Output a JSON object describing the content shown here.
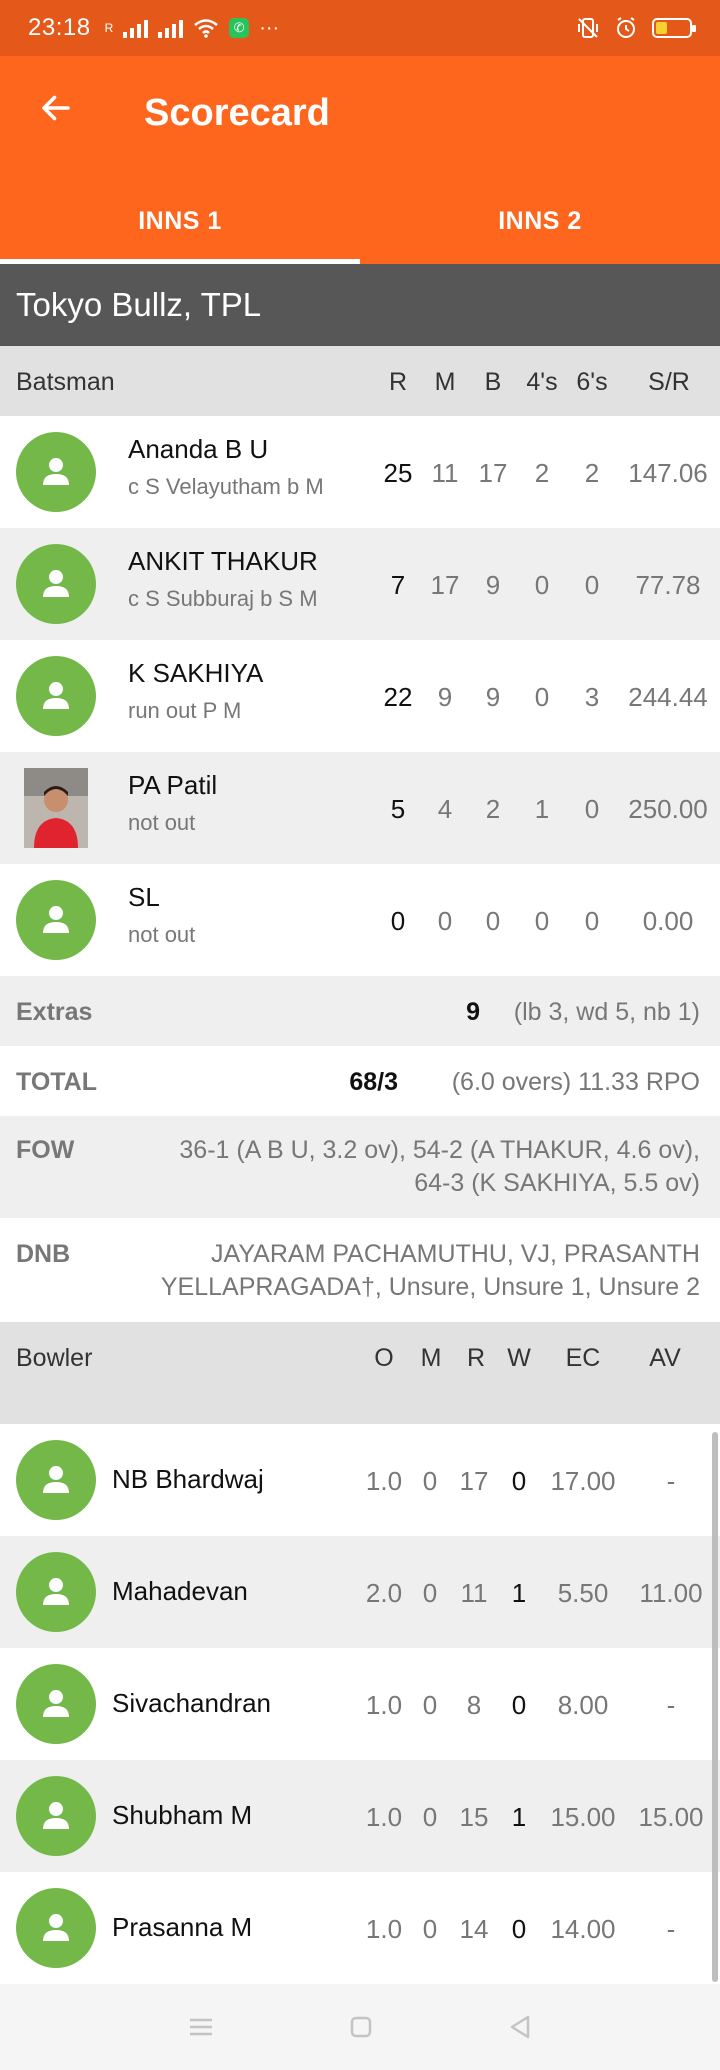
{
  "status": {
    "time": "23:18",
    "signal_label": "R",
    "more": "···"
  },
  "app": {
    "title": "Scorecard"
  },
  "tabs": [
    {
      "label": "INNS 1",
      "active": true
    },
    {
      "label": "INNS 2",
      "active": false
    }
  ],
  "team": "Tokyo Bullz, TPL",
  "batting": {
    "headers": {
      "player": "Batsman",
      "r": "R",
      "m": "M",
      "b": "B",
      "fours": "4's",
      "sixes": "6's",
      "sr": "S/R"
    },
    "rows": [
      {
        "name": "Ananda B U",
        "dismissal": "c S Velayutham b M",
        "r": "25",
        "m": "11",
        "b": "17",
        "fours": "2",
        "sixes": "2",
        "sr": "147.06",
        "avatar": "placeholder"
      },
      {
        "name": "ANKIT THAKUR",
        "dismissal": "c S Subburaj b S M",
        "r": "7",
        "m": "17",
        "b": "9",
        "fours": "0",
        "sixes": "0",
        "sr": "77.78",
        "avatar": "placeholder"
      },
      {
        "name": "K SAKHIYA",
        "dismissal": "run out P M",
        "r": "22",
        "m": "9",
        "b": "9",
        "fours": "0",
        "sixes": "3",
        "sr": "244.44",
        "avatar": "placeholder"
      },
      {
        "name": "PA Patil",
        "dismissal": "not out",
        "r": "5",
        "m": "4",
        "b": "2",
        "fours": "1",
        "sixes": "0",
        "sr": "250.00",
        "avatar": "photo"
      },
      {
        "name": "SL",
        "dismissal": "not out",
        "r": "0",
        "m": "0",
        "b": "0",
        "fours": "0",
        "sixes": "0",
        "sr": "0.00",
        "avatar": "placeholder"
      }
    ]
  },
  "extras": {
    "label": "Extras",
    "value": "9",
    "detail": "(lb 3, wd 5, nb 1)"
  },
  "total": {
    "label": "TOTAL",
    "value": "68/3",
    "detail": "(6.0 overs) 11.33 RPO"
  },
  "fow": {
    "label": "FOW",
    "line1": "36-1 (A B U, 3.2 ov), 54-2 (A THAKUR, 4.6 ov),",
    "line2": "64-3 (K SAKHIYA, 5.5 ov)"
  },
  "dnb": {
    "label": "DNB",
    "line1": "JAYARAM PACHAMUTHU, VJ, PRASANTH",
    "line2": "YELLAPRAGADA†, Unsure, Unsure 1, Unsure 2"
  },
  "bowling": {
    "headers": {
      "player": "Bowler",
      "o": "O",
      "m": "M",
      "r": "R",
      "w": "W",
      "ec": "EC",
      "av": "AV"
    },
    "rows": [
      {
        "name": "NB Bhardwaj",
        "o": "1.0",
        "m": "0",
        "r": "17",
        "w": "0",
        "ec": "17.00",
        "av": "-"
      },
      {
        "name": "Mahadevan",
        "o": "2.0",
        "m": "0",
        "r": "11",
        "w": "1",
        "ec": "5.50",
        "av": "11.00"
      },
      {
        "name": "Sivachandran",
        "o": "1.0",
        "m": "0",
        "r": "8",
        "w": "0",
        "ec": "8.00",
        "av": "-"
      },
      {
        "name": "Shubham M",
        "o": "1.0",
        "m": "0",
        "r": "15",
        "w": "1",
        "ec": "15.00",
        "av": "15.00"
      },
      {
        "name": "Prasanna M",
        "o": "1.0",
        "m": "0",
        "r": "14",
        "w": "0",
        "ec": "14.00",
        "av": "-"
      }
    ]
  },
  "colors": {
    "status_bar": "#e4581a",
    "app_bar": "#fe661e",
    "team_bar": "#575757",
    "avatar": "#75b84a"
  }
}
